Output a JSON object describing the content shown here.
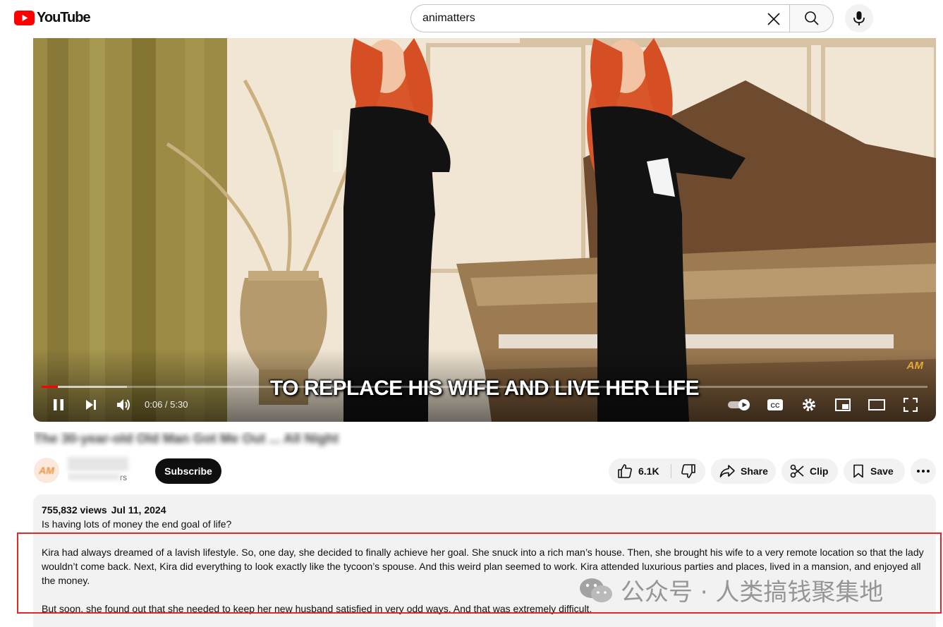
{
  "header": {
    "logo_text": "YouTube",
    "search": {
      "value": "animatters"
    }
  },
  "player": {
    "subtitle": "TO REPLACE HIS WIFE AND LIVE HER LIFE",
    "watermark": "AM",
    "time_current": "0:06",
    "time_separator": " / ",
    "time_total": "5:30",
    "progress_played": 0.018,
    "progress_buffered": 0.096
  },
  "video": {
    "title": "The 30-year-old Old Man Got Me Out ... All Night"
  },
  "channel": {
    "avatar_text": "AM",
    "subscribers_suffix": "rs",
    "subscribe_label": "Subscribe"
  },
  "actions": {
    "like_count": "6.1K",
    "share_label": "Share",
    "clip_label": "Clip",
    "save_label": "Save"
  },
  "description": {
    "views": "755,832 views",
    "date": "Jul 11, 2024",
    "line1": "Is having lots of money the end goal of life?",
    "para1": "Kira had always dreamed of a lavish lifestyle. So, one day, she decided to finally achieve her goal. She snuck into a rich man’s house. Then, she brought his wife to a very remote location so that the lady wouldn’t come back. Next, Kira did everything to look exactly like the tycoon’s spouse. And this weird plan seemed to work. Kira attended luxurious parties and places, lived in a mansion, and enjoyed all the money.",
    "para2": "But soon, she found out that she needed to keep her new husband satisfied in very odd ways. And that was extremely difficult."
  },
  "overlay_watermark": "公众号 · 人类搞钱聚集地",
  "colors": {
    "brand_red": "#ff0000",
    "highlight_red": "#e3282a",
    "pill_bg": "#f2f2f2"
  }
}
